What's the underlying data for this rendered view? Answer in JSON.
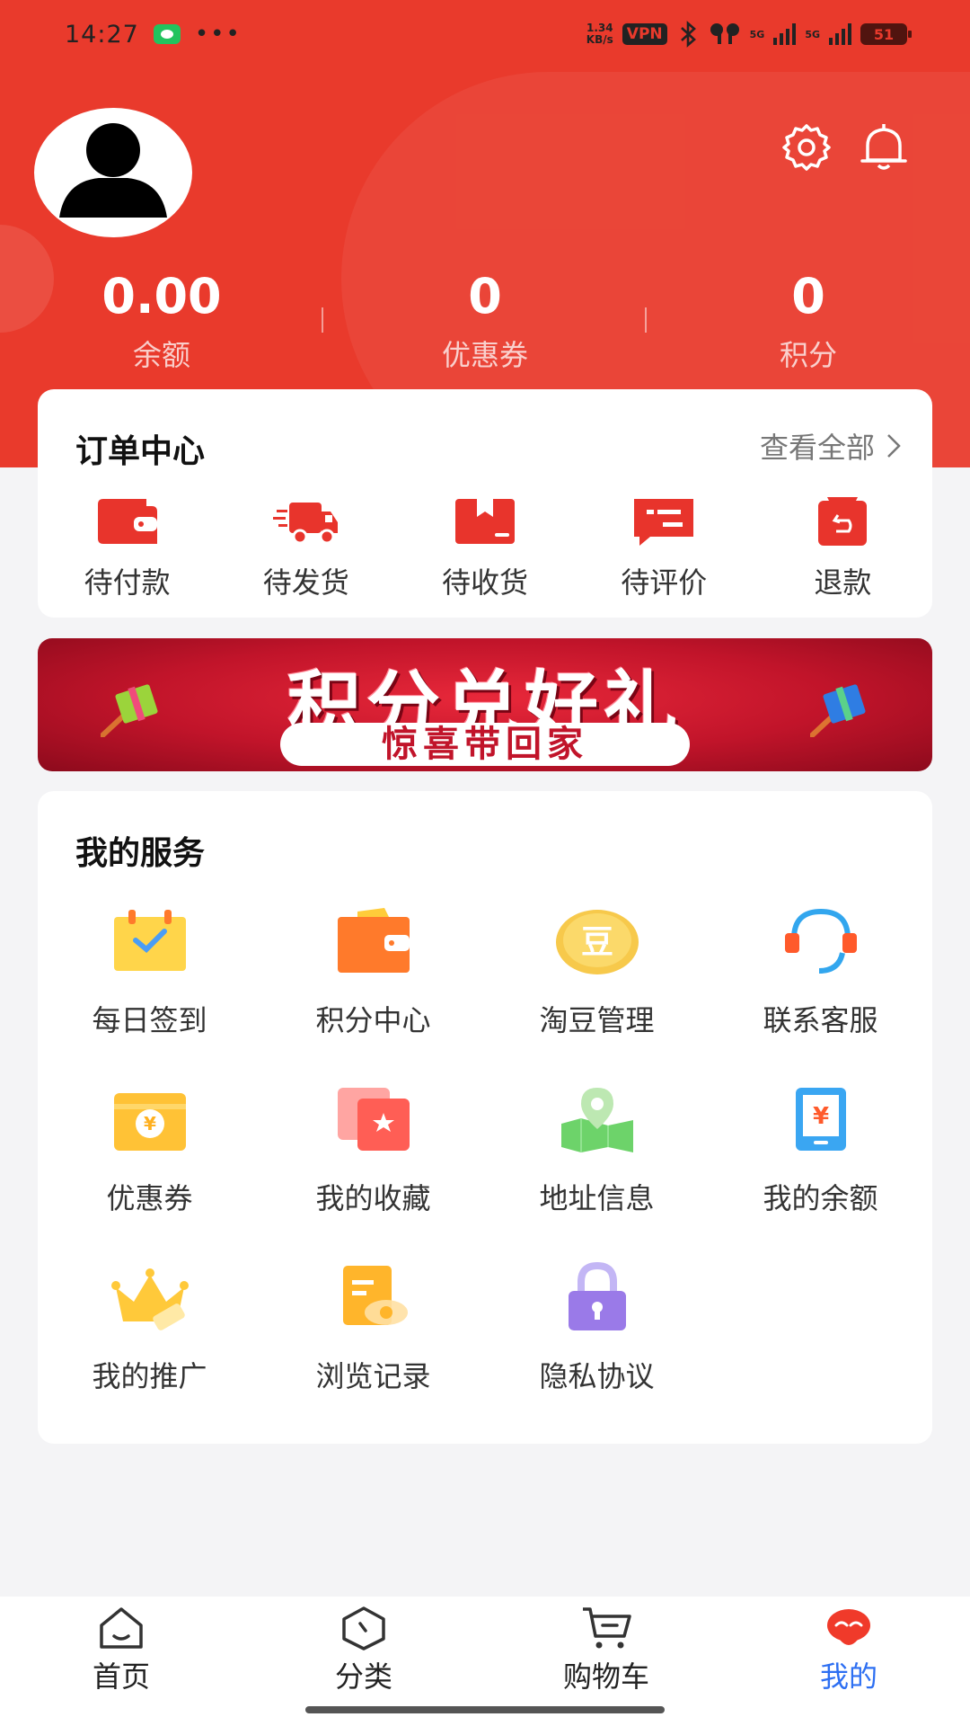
{
  "status_bar": {
    "time": "14:27",
    "speed_value": "1.34",
    "speed_unit": "KB/s",
    "vpn": "VPN",
    "net1": "5G",
    "net2": "5G",
    "battery": "51"
  },
  "stats": [
    {
      "value": "0.00",
      "label": "余额"
    },
    {
      "value": "0",
      "label": "优惠券"
    },
    {
      "value": "0",
      "label": "积分"
    }
  ],
  "orders": {
    "title": "订单中心",
    "view_all": "查看全部",
    "items": [
      {
        "label": "待付款",
        "icon": "wallet-icon"
      },
      {
        "label": "待发货",
        "icon": "delivery-truck-icon"
      },
      {
        "label": "待收货",
        "icon": "package-icon"
      },
      {
        "label": "待评价",
        "icon": "review-icon"
      },
      {
        "label": "退款",
        "icon": "refund-icon"
      }
    ]
  },
  "banner": {
    "line1": "积分兑好礼",
    "line2": "惊喜带回家"
  },
  "services": {
    "title": "我的服务",
    "items": [
      {
        "label": "每日签到",
        "icon": "calendar-check-icon"
      },
      {
        "label": "积分中心",
        "icon": "wallet-icon"
      },
      {
        "label": "淘豆管理",
        "icon": "bean-coin-icon"
      },
      {
        "label": "联系客服",
        "icon": "headset-icon"
      },
      {
        "label": "优惠券",
        "icon": "coupon-icon"
      },
      {
        "label": "我的收藏",
        "icon": "favorites-icon"
      },
      {
        "label": "地址信息",
        "icon": "map-pin-icon"
      },
      {
        "label": "我的余额",
        "icon": "balance-icon"
      },
      {
        "label": "我的推广",
        "icon": "crown-icon"
      },
      {
        "label": "浏览记录",
        "icon": "history-icon"
      },
      {
        "label": "隐私协议",
        "icon": "lock-icon"
      }
    ]
  },
  "tabbar": {
    "items": [
      {
        "label": "首页",
        "icon": "home-icon"
      },
      {
        "label": "分类",
        "icon": "category-icon"
      },
      {
        "label": "购物车",
        "icon": "cart-icon"
      },
      {
        "label": "我的",
        "icon": "profile-mascot-icon",
        "active": true
      }
    ]
  },
  "colors": {
    "brand_red": "#e93a2c",
    "active_tab": "#2d6ff2",
    "order_icon": "#e8342c"
  }
}
